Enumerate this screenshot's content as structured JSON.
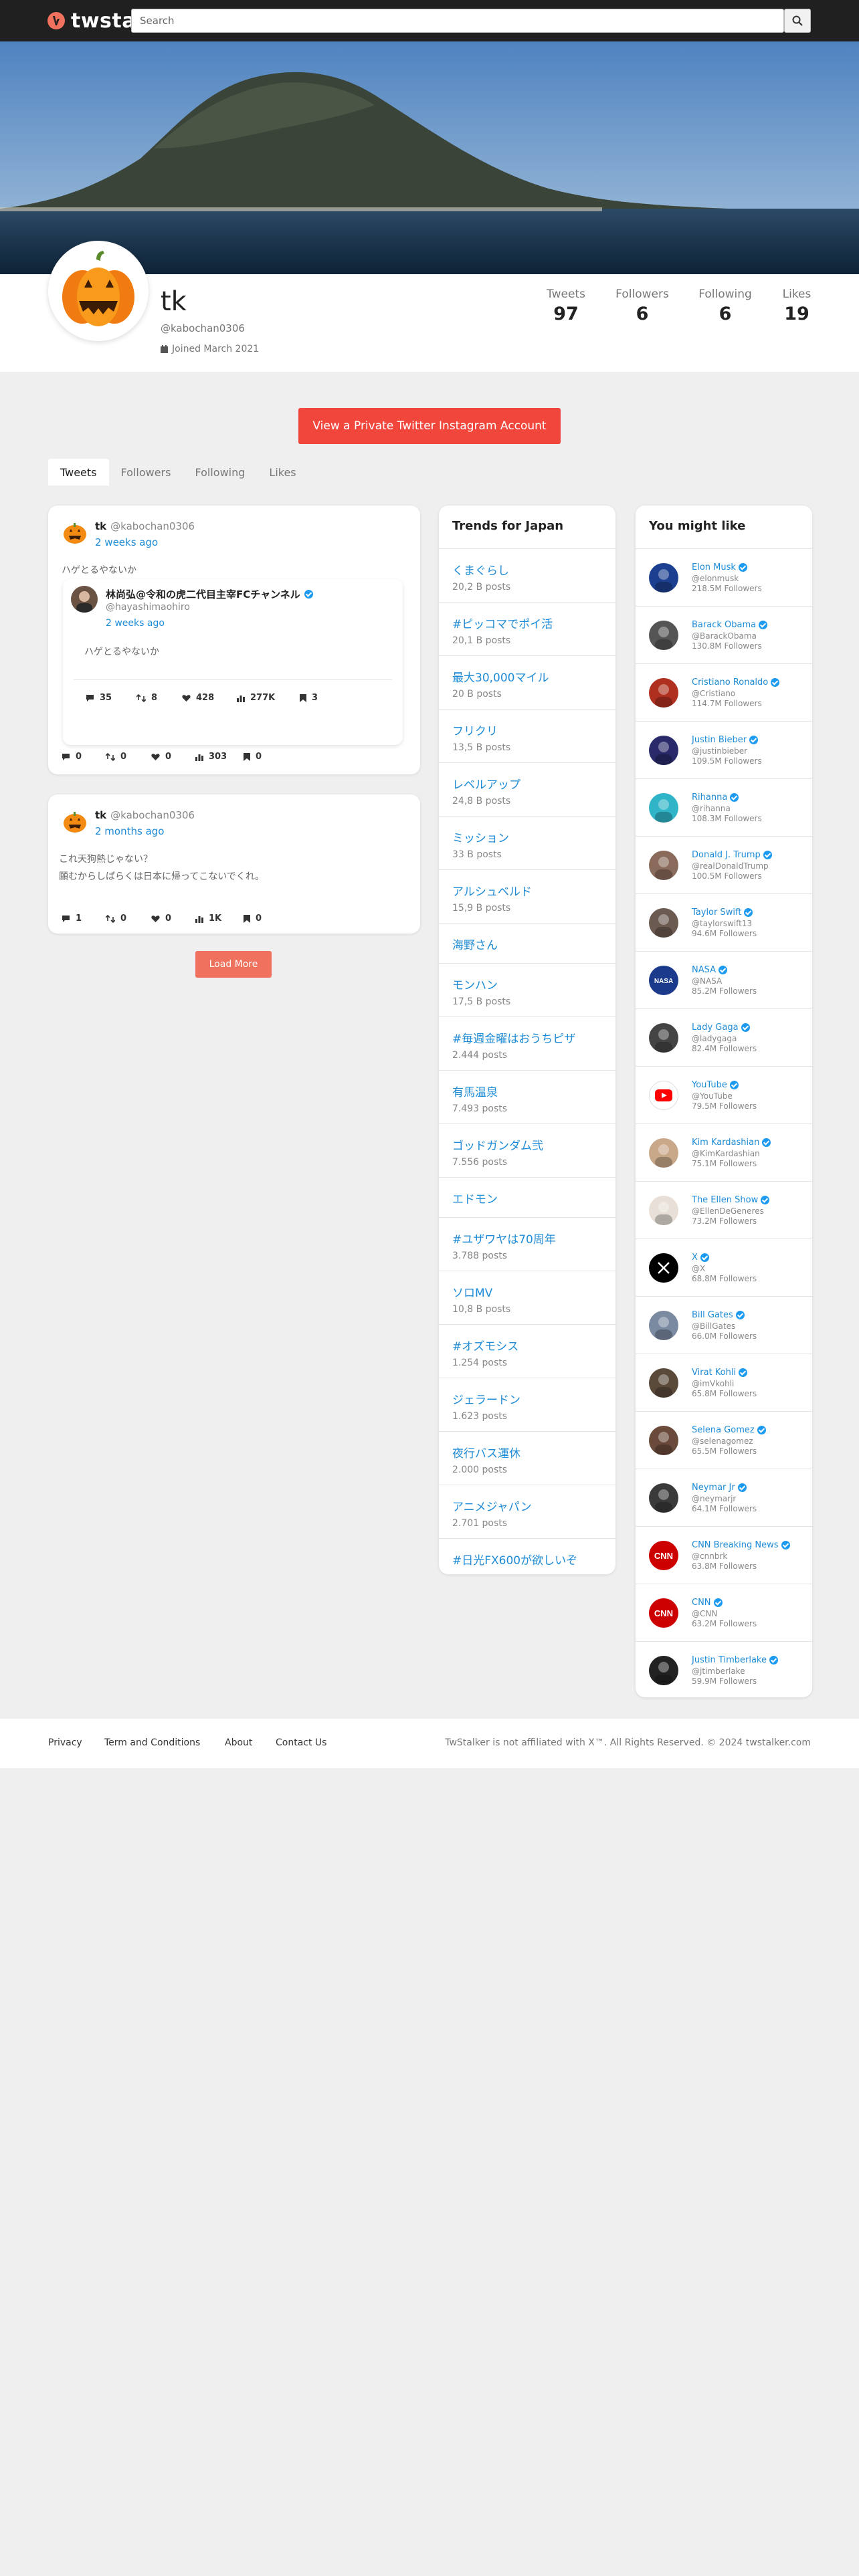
{
  "site": {
    "logo_text": "twstal",
    "search_placeholder": "Search"
  },
  "profile": {
    "name": "tk",
    "handle": "@kabochan0306",
    "joined": "Joined March 2021",
    "stats": [
      {
        "label": "Tweets",
        "value": "97"
      },
      {
        "label": "Followers",
        "value": "6"
      },
      {
        "label": "Following",
        "value": "6"
      },
      {
        "label": "Likes",
        "value": "19"
      }
    ]
  },
  "cta_label": "View a Private Twitter Instagram Account",
  "tabs": [
    "Tweets",
    "Followers",
    "Following",
    "Likes"
  ],
  "tweets": [
    {
      "name": "tk",
      "handle": "@kabochan0306",
      "time": "2 weeks ago",
      "text": "ハゲとるやないか",
      "quote": {
        "name": "林尚弘@令和の虎二代目主宰FCチャンネル",
        "handle": "@hayashimaohiro",
        "time": "2 weeks ago",
        "text": "ハゲとるやないか",
        "replies": "35",
        "retweets": "8",
        "likes": "428",
        "views": "277K",
        "bookmarks": "3"
      },
      "replies": "0",
      "retweets": "0",
      "likes": "0",
      "views": "303",
      "bookmarks": "0"
    },
    {
      "name": "tk",
      "handle": "@kabochan0306",
      "time": "2 months ago",
      "text_lines": [
        "これ天狗熱じゃない？",
        "願むからしばらくは日本に帰ってこないでくれ。"
      ],
      "replies": "1",
      "retweets": "0",
      "likes": "0",
      "views": "1K",
      "bookmarks": "0"
    }
  ],
  "load_more": "Load More",
  "trends": {
    "title": "Trends for Japan",
    "items": [
      {
        "name": "くまぐらし",
        "count": "20,2 B posts"
      },
      {
        "name": "#ピッコマでポイ活",
        "count": "20,1 B posts"
      },
      {
        "name": "最大30,000マイル",
        "count": "20 B posts"
      },
      {
        "name": "フリクリ",
        "count": "13,5 B posts"
      },
      {
        "name": "レベルアップ",
        "count": "24,8 B posts"
      },
      {
        "name": "ミッション",
        "count": "33 B posts"
      },
      {
        "name": "アルシュベルド",
        "count": "15,9 B posts"
      },
      {
        "name": "海野さん",
        "count": ""
      },
      {
        "name": "モンハン",
        "count": "17,5 B posts"
      },
      {
        "name": "#毎週金曜はおうちピザ",
        "count": "2.444 posts"
      },
      {
        "name": "有馬温泉",
        "count": "7.493 posts"
      },
      {
        "name": "ゴッドガンダム弐",
        "count": "7.556 posts"
      },
      {
        "name": "エドモン",
        "count": ""
      },
      {
        "name": "#ユザワヤは70周年",
        "count": "3.788 posts"
      },
      {
        "name": "ソロMV",
        "count": "10,8 B posts"
      },
      {
        "name": "#オズモシス",
        "count": "1.254 posts"
      },
      {
        "name": "ジェラードン",
        "count": "1.623 posts"
      },
      {
        "name": "夜行バス運休",
        "count": "2.000 posts"
      },
      {
        "name": "アニメジャパン",
        "count": "2.701 posts"
      },
      {
        "name": "#日光FX600が欲しいぞ",
        "count": ""
      }
    ]
  },
  "suggestions": {
    "title": "You might like",
    "items": [
      {
        "name": "Elon Musk",
        "handle": "@elonmusk",
        "followers": "218.5M Followers",
        "color": "#1c3f8f"
      },
      {
        "name": "Barack Obama",
        "handle": "@BarackObama",
        "followers": "130.8M Followers",
        "color": "#555555"
      },
      {
        "name": "Cristiano Ronaldo",
        "handle": "@Cristiano",
        "followers": "114.7M Followers",
        "color": "#b03020"
      },
      {
        "name": "Justin Bieber",
        "handle": "@justinbieber",
        "followers": "109.5M Followers",
        "color": "#2a2a6a"
      },
      {
        "name": "Rihanna",
        "handle": "@rihanna",
        "followers": "108.3M Followers",
        "color": "#2fb4c8"
      },
      {
        "name": "Donald J. Trump",
        "handle": "@realDonaldTrump",
        "followers": "100.5M Followers",
        "color": "#8a6a5a"
      },
      {
        "name": "Taylor Swift",
        "handle": "@taylorswift13",
        "followers": "94.6M Followers",
        "color": "#6a5a50"
      },
      {
        "name": "NASA",
        "handle": "@NASA",
        "followers": "85.2M Followers",
        "color": "#1b3a8c"
      },
      {
        "name": "Lady Gaga",
        "handle": "@ladygaga",
        "followers": "82.4M Followers",
        "color": "#444444"
      },
      {
        "name": "YouTube",
        "handle": "@YouTube",
        "followers": "79.5M Followers",
        "color": "#ffffff"
      },
      {
        "name": "Kim Kardashian",
        "handle": "@KimKardashian",
        "followers": "75.1M Followers",
        "color": "#c9a88a"
      },
      {
        "name": "The Ellen Show",
        "handle": "@EllenDeGeneres",
        "followers": "73.2M Followers",
        "color": "#e8e0d8"
      },
      {
        "name": "X",
        "handle": "@X",
        "followers": "68.8M Followers",
        "color": "#000000"
      },
      {
        "name": "Bill Gates",
        "handle": "@BillGates",
        "followers": "66.0M Followers",
        "color": "#7a8aa0"
      },
      {
        "name": "Virat Kohli",
        "handle": "@imVkohli",
        "followers": "65.8M Followers",
        "color": "#5a4a3a"
      },
      {
        "name": "Selena Gomez",
        "handle": "@selenagomez",
        "followers": "65.5M Followers",
        "color": "#6a4a3a"
      },
      {
        "name": "Neymar Jr",
        "handle": "@neymarjr",
        "followers": "64.1M Followers",
        "color": "#3a3a3a"
      },
      {
        "name": "CNN Breaking News",
        "handle": "@cnnbrk",
        "followers": "63.8M Followers",
        "color": "#cc0000"
      },
      {
        "name": "CNN",
        "handle": "@CNN",
        "followers": "63.2M Followers",
        "color": "#cc0000"
      },
      {
        "name": "Justin Timberlake",
        "handle": "@jtimberlake",
        "followers": "59.9M Followers",
        "color": "#222222"
      }
    ]
  },
  "footer": {
    "links": [
      "Privacy",
      "Term and Conditions",
      "About",
      "Contact Us"
    ],
    "copyright": "TwStalker is not affiliated with X™. All Rights Reserved. © 2024 twstalker.com"
  }
}
